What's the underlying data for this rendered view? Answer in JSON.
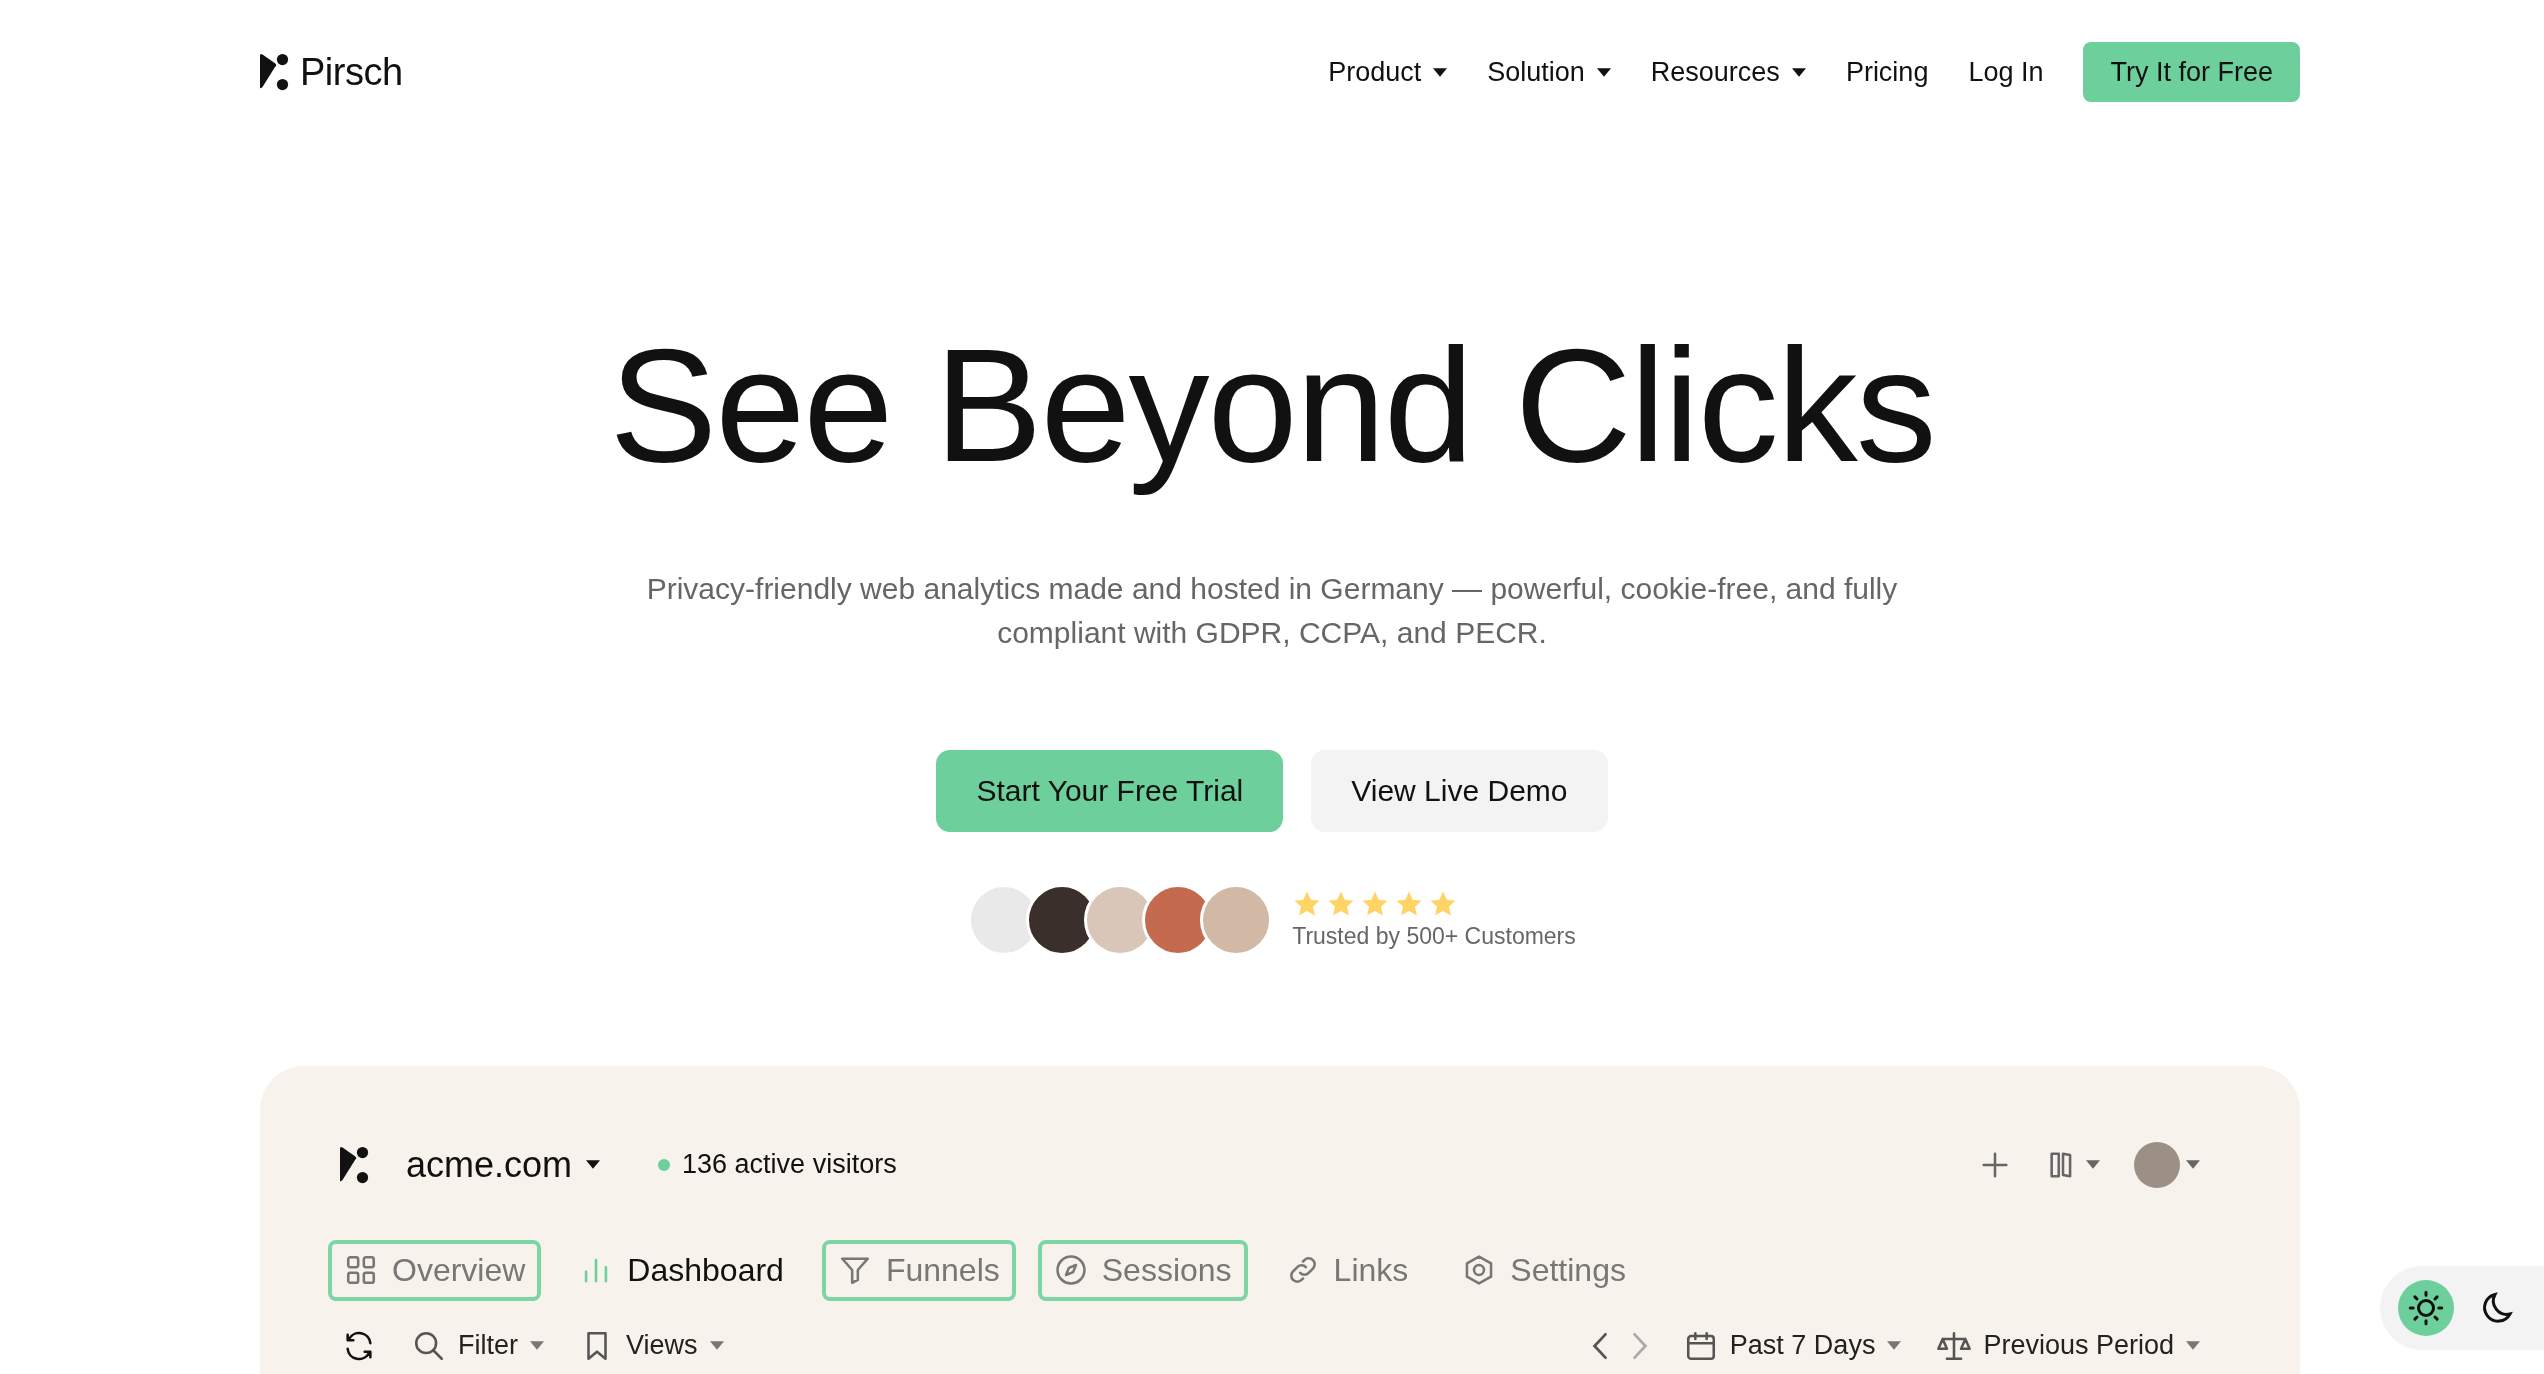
{
  "nav": {
    "brand": "Pirsch",
    "items": [
      {
        "label": "Product",
        "dropdown": true
      },
      {
        "label": "Solution",
        "dropdown": true
      },
      {
        "label": "Resources",
        "dropdown": true
      },
      {
        "label": "Pricing",
        "dropdown": false
      },
      {
        "label": "Log In",
        "dropdown": false
      }
    ],
    "cta": "Try It for Free"
  },
  "hero": {
    "title": "See Beyond Clicks",
    "subtitle": "Privacy-friendly web analytics made and hosted in Germany — powerful, cookie-free, and fully compliant with GDPR, CCPA, and PECR.",
    "buttons": [
      {
        "label": "Start Your Free Trial",
        "kind": "primary"
      },
      {
        "label": "View Live Demo",
        "kind": "secondary"
      }
    ],
    "social_proof": {
      "stars": 5,
      "text": "Trusted by 500+ Customers"
    }
  },
  "dashboard": {
    "site": "acme.com",
    "active_visitors": "136 active visitors",
    "tabs": [
      {
        "label": "Overview",
        "selected": false,
        "highlighted": true
      },
      {
        "label": "Dashboard",
        "selected": true,
        "highlighted": false
      },
      {
        "label": "Funnels",
        "selected": false,
        "highlighted": true
      },
      {
        "label": "Sessions",
        "selected": false,
        "highlighted": true
      },
      {
        "label": "Links",
        "selected": false,
        "highlighted": false
      },
      {
        "label": "Settings",
        "selected": false,
        "highlighted": false
      }
    ],
    "filter": "Filter",
    "views": "Views",
    "period": "Past 7 Days",
    "compare": "Previous Period"
  },
  "theme_toggle": [
    {
      "kind": "light",
      "selected": true
    },
    {
      "kind": "dark",
      "selected": false
    }
  ]
}
